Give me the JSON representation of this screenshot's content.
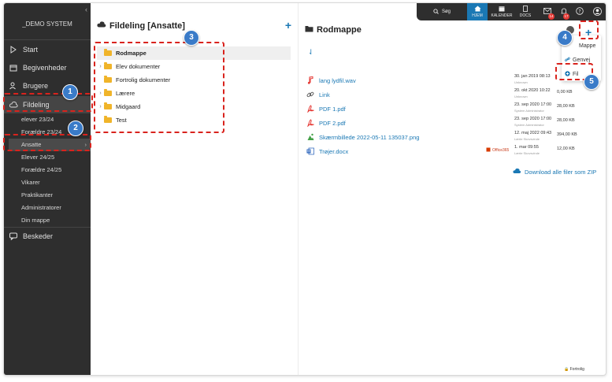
{
  "sidebar": {
    "title": "_DEMO SYSTEM",
    "items": [
      {
        "label": "Start",
        "icon": "arrow-right-icon"
      },
      {
        "label": "Begivenheder",
        "icon": "calendar-icon"
      },
      {
        "label": "Brugere",
        "icon": "users-icon"
      },
      {
        "label": "Fildeling",
        "icon": "cloud-icon"
      }
    ],
    "sub_items": [
      "elever 23/24",
      "Forældre 23/24",
      "Ansatte",
      "Elever 24/25",
      "Forældre 24/25",
      "Vikarer",
      "Praktikanter",
      "Administratorer",
      "Din mappe"
    ],
    "messages": "Beskeder"
  },
  "topbar": {
    "search": "Søg",
    "home": "HJEM",
    "calendar": "KALENDER",
    "docs": "DOCS",
    "mail_badge": "14",
    "notif_badge": "17"
  },
  "middle": {
    "title": "Fildeling [Ansatte]",
    "tree": [
      {
        "label": "Rodmappe",
        "expand": false,
        "selected": true
      },
      {
        "label": "Elev dokumenter",
        "expand": true,
        "selected": false
      },
      {
        "label": "Fortrolig dokumenter",
        "expand": false,
        "selected": false
      },
      {
        "label": "Lærere",
        "expand": true,
        "selected": false
      },
      {
        "label": "Midgaard",
        "expand": true,
        "selected": false
      },
      {
        "label": "Test",
        "expand": false,
        "selected": false
      }
    ]
  },
  "right": {
    "title": "Rodmappe",
    "files": [
      {
        "name": "lang lydfil.wav",
        "date": "30. jan 2019 08:13",
        "by": "Unknown",
        "size": "",
        "icon": "audio-file-icon",
        "color": "#e53935"
      },
      {
        "name": "Link",
        "date": "20. okt 2020 10:22",
        "by": "Unknown",
        "size": "0,00 KB",
        "icon": "link-icon",
        "color": "#555555"
      },
      {
        "name": "PDF 1.pdf",
        "date": "23. sep 2020 17:00",
        "by": "System Administrator",
        "size": "28,00 KB",
        "icon": "pdf-icon",
        "color": "#e53935"
      },
      {
        "name": "PDF 2.pdf",
        "date": "23. sep 2020 17:00",
        "by": "System Administrator",
        "size": "28,00 KB",
        "icon": "pdf-icon",
        "color": "#e53935"
      },
      {
        "name": "Skærmbillede 2022-05-11 135037.png",
        "date": "12. maj 2022 09:43",
        "by": "Lærte Skovsvinde",
        "size": "394,00 KB",
        "icon": "image-file-icon",
        "color": "#43a047"
      },
      {
        "name": "Trøjer.docx",
        "date": "1. mar 09:55",
        "by": "Lærte Skovsvinde",
        "size": "12,00 KB",
        "icon": "word-file-icon",
        "color": "#1e5bb8"
      }
    ],
    "office_label": "Office365",
    "download_label": "Download alle filer som ZIP",
    "dropdown": {
      "item1": "Mappe",
      "item2": "Genvej",
      "item3": "Fil"
    }
  },
  "footer": {
    "lock_label": "Fortrolig"
  },
  "annotations": [
    "1",
    "2",
    "3",
    "4",
    "5"
  ]
}
